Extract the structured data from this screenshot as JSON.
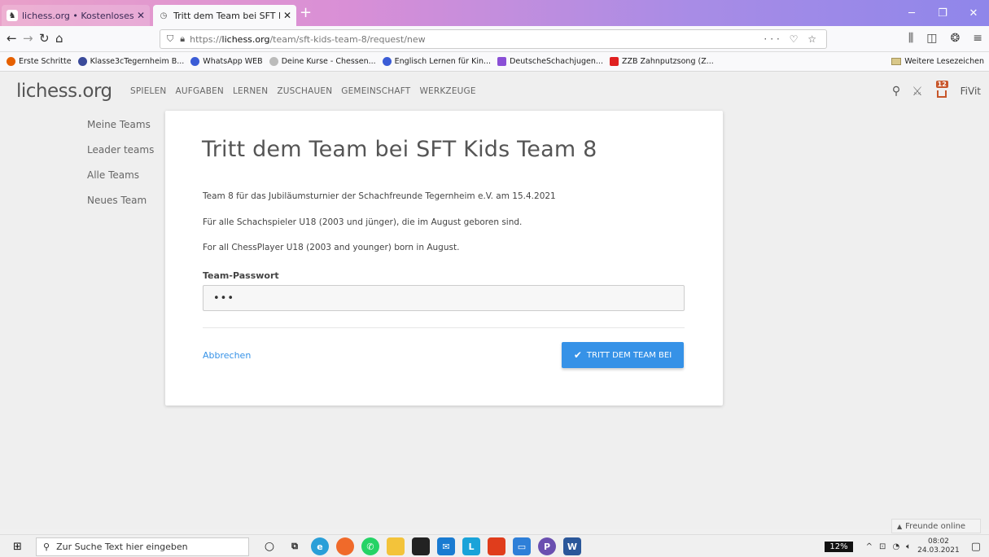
{
  "browser": {
    "tabs": [
      {
        "title": "lichess.org • Kostenloses Online",
        "active": false
      },
      {
        "title": "Tritt dem Team bei SFT Kids Te",
        "active": true
      }
    ],
    "new_tab": "+",
    "url_prefix": "https://",
    "url_domain": "lichess.org",
    "url_path": "/team/sft-kids-team-8/request/new",
    "url_extra": "··· ♡ ☆",
    "bookmarks": [
      {
        "label": "Erste Schritte",
        "color": "#e66000"
      },
      {
        "label": "Klasse3cTegernheim B...",
        "color": "#3a4a9a"
      },
      {
        "label": "WhatsApp WEB",
        "color": "#3b5cd6"
      },
      {
        "label": "Deine Kurse - Chessen...",
        "color": "#999999"
      },
      {
        "label": "Englisch Lernen für Kin...",
        "color": "#3b5cd6"
      },
      {
        "label": "DeutscheSchachjugen...",
        "color": "#8a4fd6"
      },
      {
        "label": "ZZB Zahnputzsong (Z...",
        "color": "#e02020"
      }
    ],
    "bookmarks_more": "Weitere Lesezeichen"
  },
  "site": {
    "logo": "lichess.org",
    "nav": [
      "SPIELEN",
      "AUFGABEN",
      "LERNEN",
      "ZUSCHAUEN",
      "GEMEINSCHAFT",
      "WERKZEUGE"
    ],
    "notification_count": "12",
    "username": "FiVit"
  },
  "sidebar": {
    "items": [
      "Meine Teams",
      "Leader teams",
      "Alle Teams",
      "Neues Team"
    ]
  },
  "form": {
    "title": "Tritt dem Team bei SFT Kids Team 8",
    "descriptions": [
      "Team 8 für das Jubiläumsturnier der Schachfreunde Tegernheim e.V. am 15.4.2021",
      "Für alle Schachspieler U18 (2003 und jünger), die im August geboren sind.",
      "For all ChessPlayer U18 (2003 and younger) born in August."
    ],
    "password_label": "Team-Passwort",
    "password_value": "•••",
    "cancel_label": "Abbrechen",
    "join_label": "TRITT DEM TEAM BEI",
    "accent_color": "#3692e7"
  },
  "friends_online": "Freunde online",
  "taskbar": {
    "search_placeholder": "Zur Suche Text hier eingeben",
    "battery": "12%",
    "time": "08:02",
    "date": "24.03.2021"
  }
}
